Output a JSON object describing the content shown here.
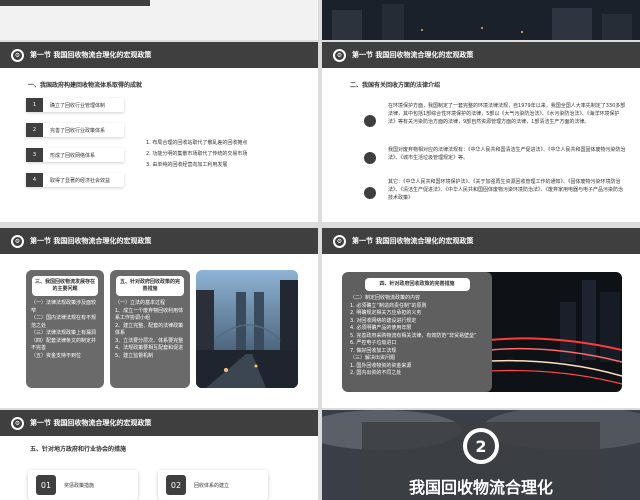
{
  "header": {
    "s1": "第一节 我国回收物流合理化的宏观政策",
    "s2": "第一节 我国回收物流合理化的宏观政策",
    "s3": "第一节 我国回收物流合理化的宏观政策",
    "s4": "第一节 我国回收物流合理化的宏观政策",
    "s5": "第一节 我国回收物流合理化的宏观政策"
  },
  "slide1": {
    "subtitle": "一、我国政府构建回收物流体系取得的成就",
    "items": [
      {
        "num": "1",
        "label": "确立了回收行业管理体制"
      },
      {
        "num": "2",
        "label": "完善了回收行业政策体系"
      },
      {
        "num": "3",
        "label": "形成了回收网络体系"
      },
      {
        "num": "4",
        "label": "取得了显著的经济社会效益"
      }
    ],
    "notes": [
      "1. 布局合理的回收站取代了散乱差的回收摊点",
      "2. 功能分明的集散市场取代了传统的交易市场",
      "3. 由单纯的回收经营向加工利用发展"
    ]
  },
  "slide2": {
    "subtitle": "二、我国有关回收方面的法律介绍",
    "paras": [
      "在环境保护方面，我国制定了一套完整的环境法律法规，自1979年以来，我国全国人大率先制定了330多部法律，其中包括1部综合性环境保护的法律，5部以《大气污染防治法》、《水污染防治法》、《海洋环境保护法》等有关污染防治方面的法律，9部自然资源管理方面的法律，1部清洁生产方面的法律。",
      "我国对废弃物相对应的法律法规有：《中华人民共和国清洁生产促进法》、《中华人民共和国固体废物污染防治法》、《城市生活垃圾管理规定》等。",
      "其它：《中华人民共和国环境保护法》、《关于加强再生资源回收管理工作的通知》、《固体废物污染环境防治法》、《清洁生产促进法》、《中华人民共和国固体废物污染环境防治法》、《废弃家用电器与电子产品污染防治技术政策》"
    ]
  },
  "slide3": {
    "card1_title": "三、我国回收物流发展存在的主要问题",
    "card1_lines": [
      "（一）法律法规政策涉及面较窄",
      "（二）国内法律法规在有不规范之处",
      "（三）法律法规政策上有漏洞",
      "（四）配套法律条文的制定并不完善",
      "（五）资金支持不到位"
    ],
    "card2_title": "五、针对政府回收政策的完善措施",
    "card2_lines": [
      "（一）立法的基本过程",
      "1、成立一个废弃物回收利用体系工作协调小组",
      "2、建立完整、配套的法律政策体系",
      "3、立法要分层次、体系要完整",
      "4、法规政策要相互配套和促进",
      "5、建立监督机制"
    ]
  },
  "slide4": {
    "card_title": "四、针对政府回收政策的完善措施",
    "lines": [
      "（二）制定回收物流政策的内容",
      "1. 必须确立“制造商责任制”的原则",
      "2. 明确规定相关方应承担的义务",
      "3. 对回收网络的建设进行规定",
      "4. 必须明确产品的使用年限",
      "5. 完善政府采购物流有相关法律，有效防范“非贸易壁垒”",
      "6. 严控电子垃圾进口",
      "7. 做好回收加工法规",
      "（三）解决出资问题",
      "1. 国外回收物资的资金来源",
      "2. 国内出资的不同之处"
    ]
  },
  "slide5": {
    "subtitle": "五、针对地方政府和行业协会的措施",
    "boxes": [
      {
        "num": "01",
        "label": "奖惩政策措施"
      },
      {
        "num": "02",
        "label": "回收体系的建立"
      }
    ]
  },
  "slide6": {
    "icon_num": "2",
    "title": "我国回收物流合理化"
  }
}
